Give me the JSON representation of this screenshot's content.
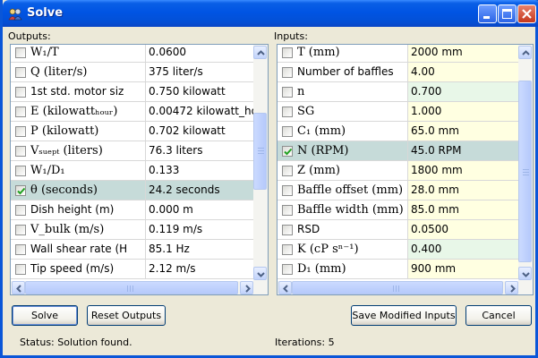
{
  "window": {
    "title": "Solve"
  },
  "outputs": {
    "label": "Outputs:",
    "rows": [
      {
        "name": "W₁/T",
        "value": "0.0600",
        "checked": false,
        "highlight": false,
        "math": true
      },
      {
        "name": "Q (liter/s)",
        "value": "375 liter/s",
        "checked": false,
        "highlight": false,
        "math": true
      },
      {
        "name": "1st std. motor siz",
        "value": "0.750 kilowatt",
        "checked": false,
        "highlight": false,
        "math": false
      },
      {
        "name": "E (kilowattₕₒᵤᵣ)",
        "value": "0.00472 kilowatt_ho",
        "checked": false,
        "highlight": false,
        "math": true
      },
      {
        "name": "P (kilowatt)",
        "value": "0.702 kilowatt",
        "checked": false,
        "highlight": false,
        "math": true
      },
      {
        "name": "Vₛᵤₑₚₜ (liters)",
        "value": "76.3 liters",
        "checked": false,
        "highlight": false,
        "math": true
      },
      {
        "name": "W₁/D₁",
        "value": "0.133",
        "checked": false,
        "highlight": false,
        "math": true
      },
      {
        "name": "θ (seconds)",
        "value": "24.2 seconds",
        "checked": true,
        "highlight": true,
        "math": true
      },
      {
        "name": "Dish height (m)",
        "value": "0.000 m",
        "checked": false,
        "highlight": false,
        "math": false
      },
      {
        "name": "V_bulk (m/s)",
        "value": "0.119 m/s",
        "checked": false,
        "highlight": false,
        "math": true
      },
      {
        "name": "Wall shear rate (H",
        "value": "85.1 Hz",
        "checked": false,
        "highlight": false,
        "math": false
      },
      {
        "name": "Tip speed (m/s)",
        "value": "2.12 m/s",
        "checked": false,
        "highlight": false,
        "math": false
      }
    ]
  },
  "inputs": {
    "label": "Inputs:",
    "rows": [
      {
        "name": "T (mm)",
        "value": "2000 mm",
        "checked": false,
        "highlight": false,
        "math": true
      },
      {
        "name": "Number of baffles",
        "value": "4.00",
        "checked": false,
        "highlight": false,
        "math": false
      },
      {
        "name": "n",
        "value": "0.700",
        "checked": false,
        "highlight": false,
        "math": true
      },
      {
        "name": "SG",
        "value": "1.000",
        "checked": false,
        "highlight": false,
        "math": true
      },
      {
        "name": "C₁ (mm)",
        "value": "65.0 mm",
        "checked": false,
        "highlight": false,
        "math": true
      },
      {
        "name": "N (RPM)",
        "value": "45.0 RPM",
        "checked": true,
        "highlight": true,
        "math": true
      },
      {
        "name": "Z (mm)",
        "value": "1800 mm",
        "checked": false,
        "highlight": false,
        "math": true
      },
      {
        "name": "Baffle offset (mm)",
        "value": "28.0 mm",
        "checked": false,
        "highlight": false,
        "math": true
      },
      {
        "name": "Baffle width (mm)",
        "value": "85.0 mm",
        "checked": false,
        "highlight": false,
        "math": true
      },
      {
        "name": "RSD",
        "value": "0.0500",
        "checked": false,
        "highlight": false,
        "math": false
      },
      {
        "name": "K (cP sⁿ⁻¹)",
        "value": "0.400",
        "checked": false,
        "highlight": false,
        "math": true
      },
      {
        "name": "D₁ (mm)",
        "value": "900 mm",
        "checked": false,
        "highlight": false,
        "math": true
      }
    ]
  },
  "buttons": {
    "solve": "Solve",
    "reset_outputs": "Reset Outputs",
    "save_modified_inputs": "Save Modified Inputs",
    "cancel": "Cancel"
  },
  "status": {
    "text": "Status: Solution found.",
    "iterations": "Iterations: 5"
  },
  "colors": {
    "title_bar": "#0054e3",
    "input_value_bg": "#ffffe1",
    "input_value_alt_bg": "#e8f7e8",
    "selected_row_bg": "#c6dbd9"
  }
}
